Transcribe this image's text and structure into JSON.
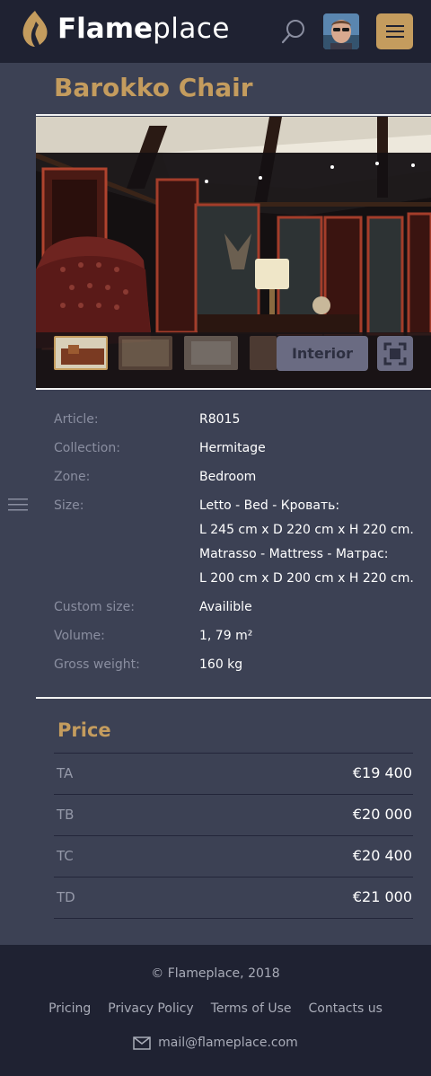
{
  "header": {
    "logo_bold": "Flame",
    "logo_light": "place"
  },
  "product": {
    "title": "Barokko Chair",
    "gallery": {
      "category_label": "Interior"
    },
    "specs": [
      {
        "label": "Article:",
        "lines": [
          "R8015"
        ]
      },
      {
        "label": "Collection:",
        "lines": [
          "Hermitage"
        ]
      },
      {
        "label": "Zone:",
        "lines": [
          "Bedroom"
        ]
      },
      {
        "label": "Size:",
        "lines": [
          "Letto - Bed - Кровать:",
          "L 245 cm x D 220 cm x H 220 cm.",
          "Matrasso - Mattress - Матрас:",
          "L 200 cm x D 200 cm x H 220 cm."
        ]
      },
      {
        "label": "Custom size:",
        "lines": [
          "Availible"
        ]
      },
      {
        "label": "Volume:",
        "lines": [
          "1, 79 m²"
        ]
      },
      {
        "label": "Gross weight:",
        "lines": [
          "160 kg"
        ]
      }
    ]
  },
  "price": {
    "title": "Price",
    "rows": [
      {
        "tier": "TA",
        "amount": "€19 400"
      },
      {
        "tier": "TB",
        "amount": "€20 000"
      },
      {
        "tier": "TC",
        "amount": "€20 400"
      },
      {
        "tier": "TD",
        "amount": "€21 000"
      }
    ]
  },
  "footer": {
    "copyright": "© Flameplace, 2018",
    "links": [
      "Pricing",
      "Privacy Policy",
      "Terms of Use",
      "Contacts us"
    ],
    "email": "mail@flameplace.com"
  },
  "colors": {
    "background": "#1f2232",
    "panel": "#3c4154",
    "accent_gold": "#c49c5e",
    "muted_text": "#8a8ea0",
    "button_muted": "#6a6b82"
  },
  "icons": {
    "logo": "flame-icon",
    "search": "search-icon",
    "menu": "hamburger-icon",
    "rail": "list-icon",
    "fullscreen": "fullscreen-icon",
    "email": "mail-icon"
  }
}
